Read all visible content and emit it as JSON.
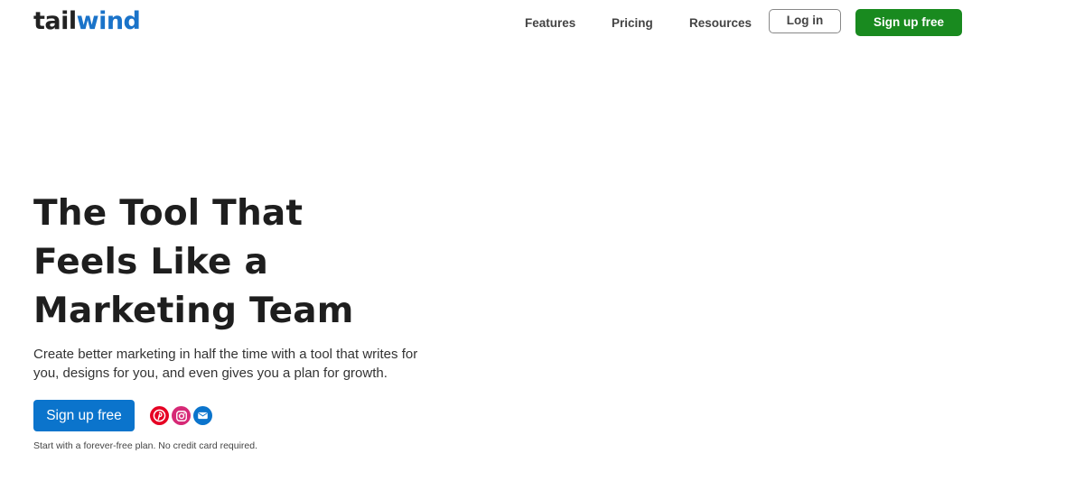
{
  "header": {
    "logo_part1": "tail",
    "logo_part2": "wind",
    "nav": [
      {
        "label": "Features"
      },
      {
        "label": "Pricing"
      },
      {
        "label": "Resources"
      }
    ],
    "login_label": "Log in",
    "signup_label": "Sign up free"
  },
  "hero": {
    "title": "The Tool That Feels Like a Marketing Team",
    "subtitle": "Create better marketing in half the time with a tool that writes for you, designs for you, and even gives you a plan for growth.",
    "cta_label": "Sign up free",
    "icons": [
      "pinterest-icon",
      "instagram-icon",
      "email-icon"
    ],
    "note": "Start with a forever-free plan. No credit card required."
  },
  "colors": {
    "brand_blue": "#1a73c9",
    "cta_blue": "#0b74cc",
    "signup_green": "#198a1f",
    "pinterest": "#e60023",
    "instagram": "#d62976"
  }
}
